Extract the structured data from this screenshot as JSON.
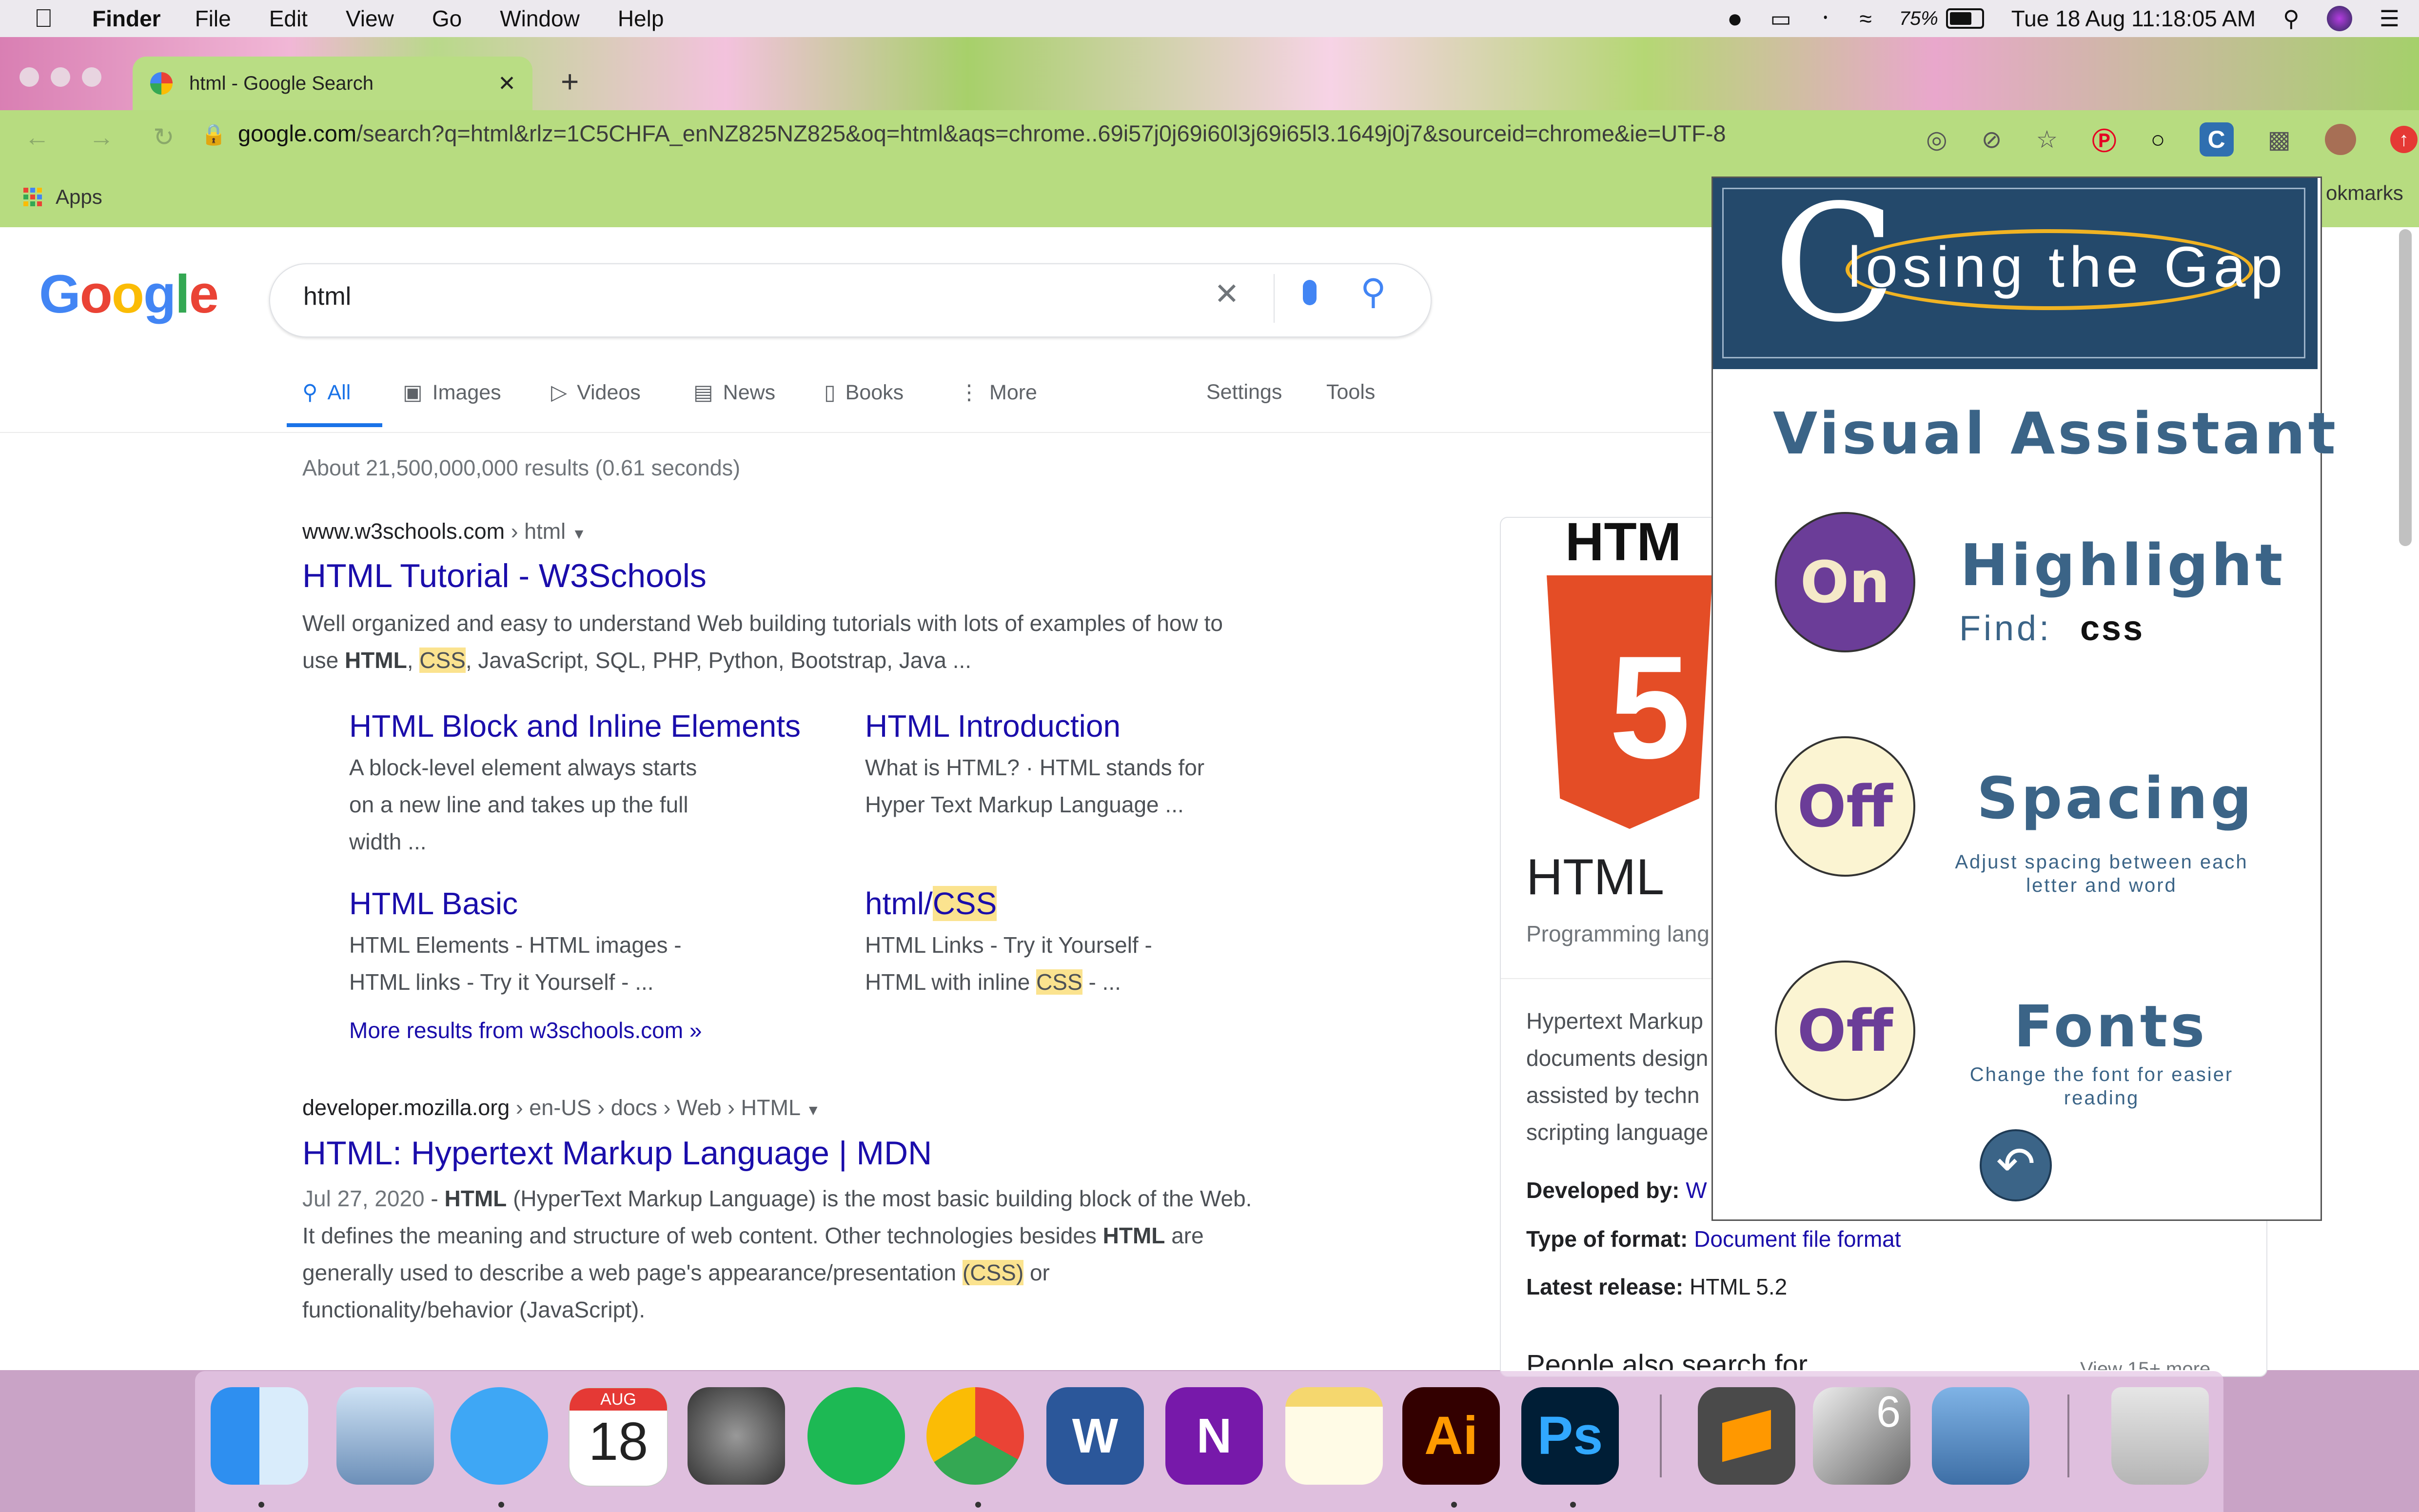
{
  "menubar": {
    "app": "Finder",
    "items": [
      "File",
      "Edit",
      "View",
      "Go",
      "Window",
      "Help"
    ],
    "battery": "75%",
    "datetime": "Tue 18 Aug  11:18:05 AM"
  },
  "browser": {
    "tab_title": "html - Google Search",
    "url_host": "google.com",
    "url_rest": "/search?q=html&rlz=1C5CHFA_enNZ825NZ825&oq=html&aqs=chrome..69i57j0j69i60l3j69i65l3.1649j0j7&sourceid=chrome&ie=UTF-8",
    "bookmarks_apps": "Apps",
    "bookmarks_right": "okmarks"
  },
  "search": {
    "logo": "Google",
    "query": "html",
    "tabs": [
      "All",
      "Images",
      "Videos",
      "News",
      "Books",
      "More"
    ],
    "settings": "Settings",
    "tools": "Tools",
    "stats": "About 21,500,000,000 results (0.61 seconds)"
  },
  "results": {
    "r1": {
      "cite_domain": "www.w3schools.com",
      "cite_path": " › html",
      "title": "HTML Tutorial - W3Schools",
      "snippet_line1": "Well organized and easy to understand Web building tutorials with lots of examples of how to",
      "snippet_use": "use ",
      "snippet_html": "HTML",
      "snippet_comma": ", ",
      "snippet_css": "CSS",
      "snippet_rest": ", JavaScript, SQL, PHP, Python, Bootstrap, Java ...",
      "sitelinks": [
        {
          "title": "HTML Block and Inline Elements",
          "l1": "A block-level element always starts",
          "l2": "on a new line and takes up the full",
          "l3": "width ..."
        },
        {
          "title": "HTML Introduction",
          "l1": "What is HTML? · HTML stands for",
          "l2": "Hyper Text Markup Language ...",
          "l3": ""
        },
        {
          "title": "HTML Basic",
          "l1": "HTML Elements - HTML images -",
          "l2": "HTML links - Try it Yourself - ...",
          "l3": ""
        },
        {
          "title_pre": "html/",
          "title_hl": "CSS",
          "l1": "HTML Links - Try it Yourself -",
          "l2_pre": "HTML with inline ",
          "l2_hl": "CSS",
          "l2_post": " - ..."
        }
      ],
      "more": "More results from w3schools.com »"
    },
    "r2": {
      "cite_domain": "developer.mozilla.org",
      "cite_path": " › en-US › docs › Web › HTML",
      "title": "HTML: Hypertext Markup Language | MDN",
      "date": "Jul 27, 2020",
      "s1a": " - ",
      "s1b": "HTML",
      "s1c": " (HyperText Markup Language) is the most basic building block of the Web.",
      "s2a": "It defines the meaning and structure of web content. Other technologies besides ",
      "s2b": "HTML",
      "s2c": " are",
      "s3a": "generally used to describe a web page's appearance/presentation ",
      "s3b": "(CSS)",
      "s3c": " or",
      "s4": "functionality/behavior (JavaScript)."
    }
  },
  "knowledge": {
    "logo_text": "HTM",
    "title": "HTML",
    "subtitle": "Programming lang",
    "desc": [
      "Hypertext Markup",
      "documents design",
      "assisted by techn",
      "scripting language"
    ],
    "dev_label": "Developed by:",
    "dev_value": "W",
    "format_label": "Type of format:",
    "format_value": "Document file format",
    "release_label": "Latest release:",
    "release_value": "HTML 5.2",
    "people": "People also search for",
    "view_more": "View 15+ more"
  },
  "extension": {
    "brand_c": "C",
    "brand_rest": "losing the Gap",
    "title": "Visual Assistant",
    "highlight": {
      "state": "On",
      "label": "Highlight",
      "find_label": "Find:",
      "find_value": "css"
    },
    "spacing": {
      "state": "Off",
      "label": "Spacing",
      "desc1": "Adjust spacing between each",
      "desc2": "letter and word"
    },
    "fonts": {
      "state": "Off",
      "label": "Fonts",
      "desc1": "Change the font for easier",
      "desc2": "reading"
    },
    "colors": {
      "header": "#24496b",
      "on": "#6b3d98",
      "off": "#fbf4d2",
      "text": "#3b6487"
    }
  },
  "dock": {
    "calendar_month": "AUG",
    "calendar_day": "18",
    "apps": [
      "finder-icon",
      "mail-eagle-icon",
      "messages-icon",
      "calendar-icon",
      "system-preferences-icon",
      "spotify-icon",
      "chrome-icon",
      "word-icon",
      "onenote-icon",
      "notes-icon",
      "illustrator-icon",
      "photoshop-icon",
      "sublime-icon",
      "rhino-icon",
      "preview-icon",
      "trash-icon"
    ],
    "word_letter": "W",
    "onenote_letter": "N",
    "ai_text": "Ai",
    "ps_text": "Ps",
    "rhino_badge": "6"
  }
}
